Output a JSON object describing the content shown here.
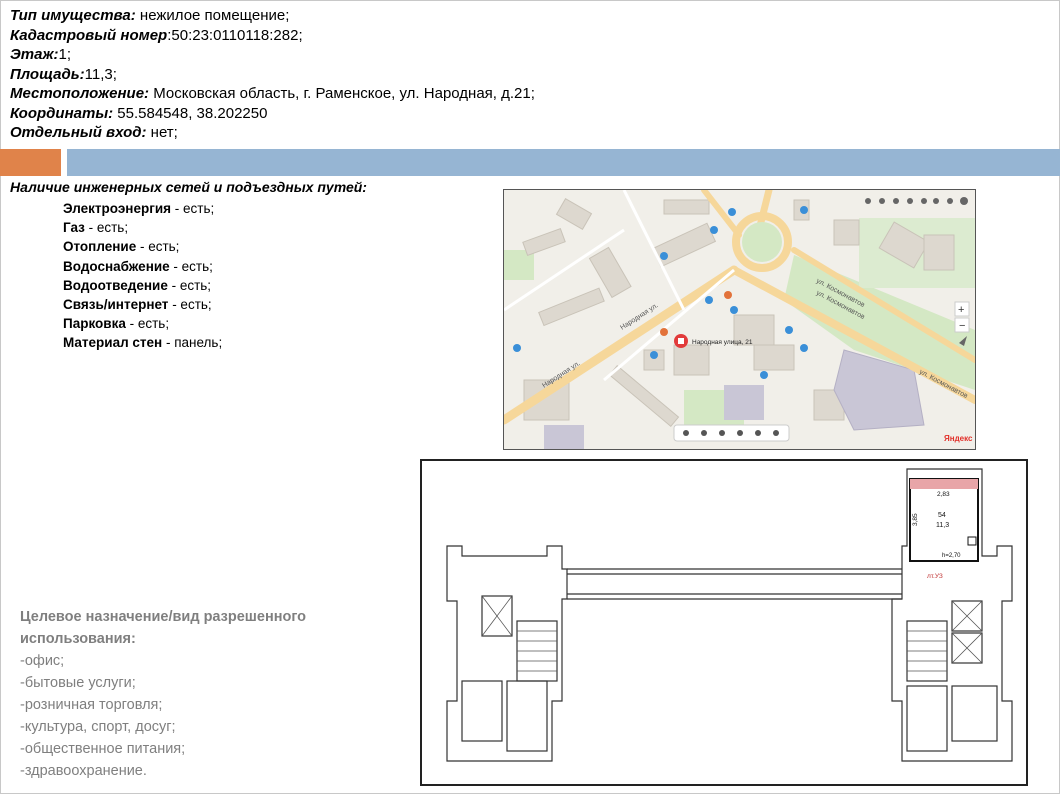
{
  "properties": [
    {
      "label": "Тип имущества:",
      "value": " нежилое помещение;"
    },
    {
      "label": "Кадастровый номер",
      "value": ":50:23:0110118:282;"
    },
    {
      "label": "Этаж:",
      "value": "1;"
    },
    {
      "label": "Площадь:",
      "value": "11,3;"
    },
    {
      "label": "Местоположение:",
      "value": " Московская область, г. Раменское, ул. Народная, д.21;"
    },
    {
      "label": "Координаты:",
      "value": " 55.584548, 38.202250"
    },
    {
      "label": "Отдельный вход:",
      "value": " нет;"
    }
  ],
  "engineering": {
    "title": "Наличие инженерных сетей и подъездных путей:",
    "items": [
      {
        "label": "Электроэнергия",
        "value": " - есть;"
      },
      {
        "label": "Газ",
        "value": " - есть;"
      },
      {
        "label": "Отопление",
        "value": " - есть;"
      },
      {
        "label": "Водоснабжение",
        "value": " - есть;"
      },
      {
        "label": "Водоотведение",
        "value": " - есть;"
      },
      {
        "label": "Связь/интернет",
        "value": " - есть;"
      },
      {
        "label": "Парковка",
        "value": " - есть;"
      },
      {
        "label": "Материал стен",
        "value": " - панель;"
      }
    ]
  },
  "map": {
    "marker_label": "Народная улица, 21",
    "streets": [
      "Народная ул.",
      "Народная ул.",
      "ул. Космонавтов",
      "ул. Космонавтов",
      "ул. Космонавтов"
    ],
    "brand": "Яндекс"
  },
  "floor_plan": {
    "room_number": "54",
    "room_area": "11,3",
    "width_dim": "2,83",
    "depth_dim": "3,85",
    "height_dim": "h=2,70",
    "mark": "лт.УЗ"
  },
  "purpose": {
    "title_line1": "Целевое назначение/вид разрешенного",
    "title_line2": "использования:",
    "items": [
      "-офис;",
      "-бытовые услуги;",
      "-розничная торговля;",
      "-культура, спорт, досуг;",
      "-общественное питания;",
      "-здравоохранение."
    ]
  },
  "colors": {
    "accent_orange": "#e0834a",
    "accent_blue": "#96b5d3",
    "muted_text": "#7f7f7f"
  }
}
